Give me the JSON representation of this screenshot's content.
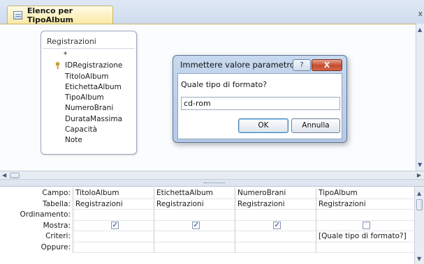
{
  "tab": {
    "title": "Elenco per TipoAlbum",
    "close_glyph": "x"
  },
  "table_box": {
    "title": "Registrazioni",
    "fields": [
      "*",
      "IDRegistrazione",
      "TitoloAlbum",
      "EtichettaAlbum",
      "TipoAlbum",
      "NumeroBrani",
      "DurataMassima",
      "Capacità",
      "Note"
    ],
    "primary_key_field": "IDRegistrazione"
  },
  "dialog": {
    "title": "Immettere valore parametro",
    "help_glyph": "?",
    "close_glyph": "X",
    "prompt": "Quale tipo di formato?",
    "input_value": "cd-rom",
    "ok_label": "OK",
    "cancel_label": "Annulla"
  },
  "grid": {
    "row_labels": [
      "Campo:",
      "Tabella:",
      "Ordinamento:",
      "Mostra:",
      "Criteri:",
      "Oppure:"
    ],
    "columns": [
      {
        "campo": "TitoloAlbum",
        "tabella": "Registrazioni",
        "ordinamento": "",
        "mostra": true,
        "criteri": "",
        "oppure": ""
      },
      {
        "campo": "EtichettaAlbum",
        "tabella": "Registrazioni",
        "ordinamento": "",
        "mostra": true,
        "criteri": "",
        "oppure": ""
      },
      {
        "campo": "NumeroBrani",
        "tabella": "Registrazioni",
        "ordinamento": "",
        "mostra": true,
        "criteri": "",
        "oppure": ""
      },
      {
        "campo": "TipoAlbum",
        "tabella": "Registrazioni",
        "ordinamento": "",
        "mostra": false,
        "criteri": "[Quale tipo di formato?]",
        "oppure": ""
      }
    ]
  },
  "icons": [
    "query-icon",
    "key-icon",
    "help-icon",
    "close-icon",
    "scroll-left-icon",
    "scroll-right-icon",
    "scroll-up-icon",
    "scroll-down-icon"
  ]
}
